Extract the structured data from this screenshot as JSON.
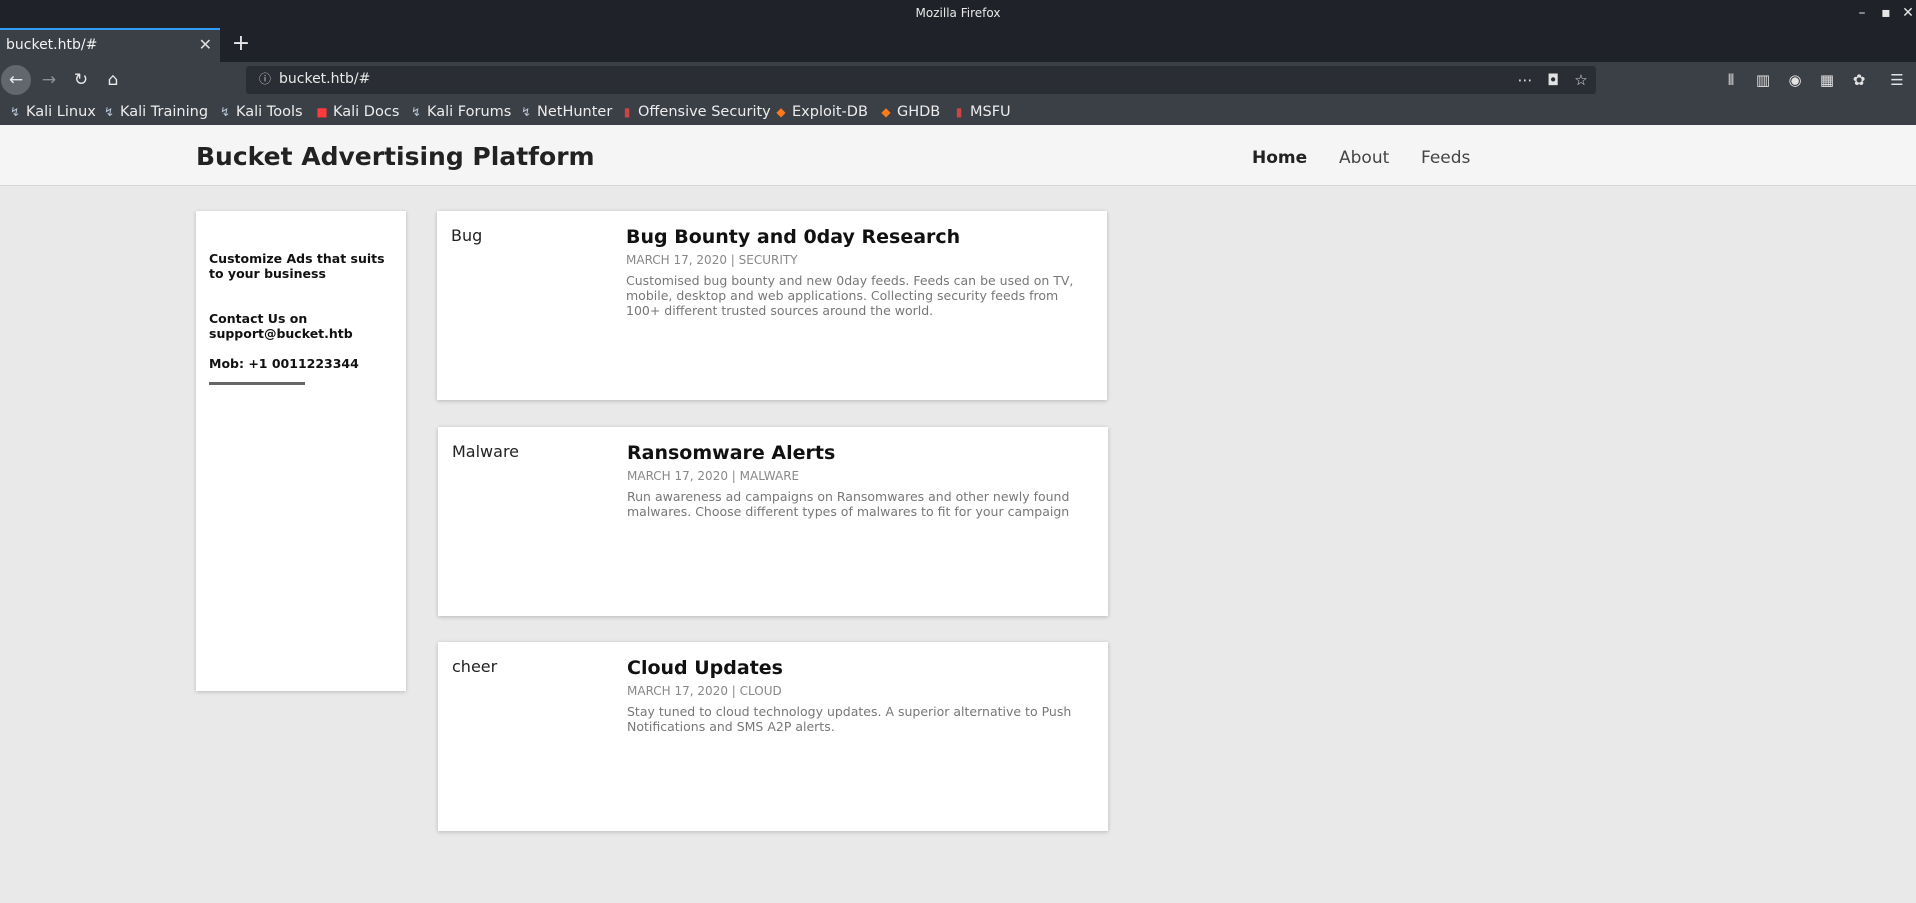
{
  "window": {
    "title": "Mozilla Firefox"
  },
  "tab": {
    "label": "bucket.htb/#"
  },
  "urlbar": {
    "url": "bucket.htb/#"
  },
  "bookmarks": [
    {
      "label": "Kali Linux",
      "icon": "kali-dragon-icon"
    },
    {
      "label": "Kali Training",
      "icon": "kali-dragon-icon"
    },
    {
      "label": "Kali Tools",
      "icon": "kali-dragon-icon"
    },
    {
      "label": "Kali Docs",
      "icon": "red-doc-icon"
    },
    {
      "label": "Kali Forums",
      "icon": "kali-dragon-icon"
    },
    {
      "label": "NetHunter",
      "icon": "nethunter-icon"
    },
    {
      "label": "Offensive Security",
      "icon": "offsec-icon"
    },
    {
      "label": "Exploit-DB",
      "icon": "exploitdb-icon"
    },
    {
      "label": "GHDB",
      "icon": "ghdb-icon"
    },
    {
      "label": "MSFU",
      "icon": "msfu-icon"
    }
  ],
  "site": {
    "title": "Bucket Advertising Platform",
    "nav": [
      "Home",
      "About",
      "Feeds"
    ]
  },
  "sidebar": {
    "tagline": "Customize Ads that suits to your business",
    "contact": "Contact Us on support@bucket.htb",
    "mobile": "Mob: +1 0011223344"
  },
  "feeds": [
    {
      "category": "Bug",
      "title": "Bug Bounty and 0day Research",
      "meta": "MARCH 17, 2020 | SECURITY",
      "description": "Customised bug bounty and new 0day feeds. Feeds can be used on TV, mobile, desktop and web applications. Collecting security feeds from 100+ different trusted sources around the world."
    },
    {
      "category": "Malware",
      "title": "Ransomware Alerts",
      "meta": "MARCH 17, 2020 | MALWARE",
      "description": "Run awareness ad campaigns on Ransomwares and other newly found malwares. Choose different types of malwares to fit for your campaign"
    },
    {
      "category": "cheer",
      "title": "Cloud Updates",
      "meta": "MARCH 17, 2020 | CLOUD",
      "description": "Stay tuned to cloud technology updates. A superior alternative to Push Notifications and SMS A2P alerts."
    }
  ]
}
